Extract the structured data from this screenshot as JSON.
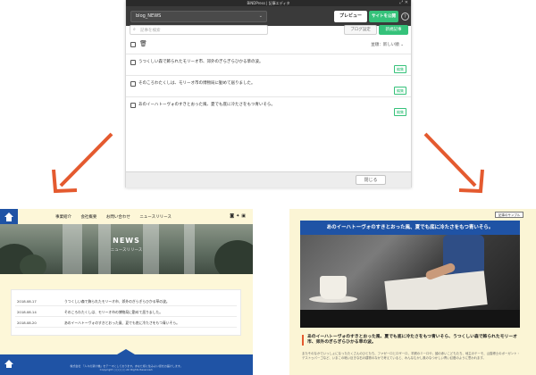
{
  "editor": {
    "window_title": "BiNDPress | 記事エディタ",
    "blog_select": "blog_NEWS",
    "preview_label": "プレビュー",
    "publish_label": "サイトを公開",
    "help_label": "?",
    "search_placeholder": "記事を検索",
    "blog_settings_label": "ブログ設定",
    "new_post_label": "新規記事",
    "sort_label": "並順：新しい順",
    "posts": [
      {
        "title": "うつくしい森で飾られたモリーオ市、郊外のぎらぎらひかる草の波。",
        "edit": "編集"
      },
      {
        "title": "そのころわたくしは、モリーオ市の博物局に勤めて居りました。",
        "edit": "編集"
      },
      {
        "title": "あのイーハトーヴォのすきとおった風、夏でも底に冷たさをもつ青いそら。",
        "edit": "編集"
      }
    ],
    "close_label": "閉じる"
  },
  "site_left": {
    "nav": [
      "事業紹介",
      "会社概要",
      "お問い合わせ",
      "ニュースリリース"
    ],
    "hero_title": "NEWS",
    "hero_sub": "ニュースリリース",
    "news": [
      {
        "date": "2018.08.17",
        "title": "うつくしい森で飾られたモリーオ市、郊外のぎらぎらひかる草の波。"
      },
      {
        "date": "2018.08.14",
        "title": "そのころわたくしは、モリーオ市の博物局に勤めて居りました。"
      },
      {
        "date": "2018.08.20",
        "title": "あのイーハトーヴォのすきとおった風、夏でも底に冷たさをもつ青いそら。"
      }
    ],
    "footer_logo": "株式会社",
    "footer_text": "「人々の架け橋」をテーマにしております。あなた様に住みよい街をお届けします。",
    "copyright": "Copyright ○○○○○ All Rights Reserved."
  },
  "site_right": {
    "tag": "記事のサンプル",
    "banner": "あのイーハトーヴォのすきとおった風、夏でも底に冷たさをもつ青いそら。",
    "headline": "あのイーハトーヴォのすきとおった風、夏でも底に冷たさをもつ青いそら、うつくしい森で飾られたモリーオ市、郊外のぎらぎらひかる草の波。",
    "body": "またそのなかでいっしょになったたくさんのひとたち、ファゼーロとロザーロ、羊飼のミーロや、顔の赤いこどもたち、地主のテーモ、山猫博士のボーガント・デストゥパーゴなど、いまこの暗い巨きな石の建物のなかで考えていると、みんなむかし風のなつかしい青い幻燈のように思われます。"
  },
  "colors": {
    "accent_green": "#35c27a",
    "brand_blue": "#1f53a5",
    "arrow_orange": "#e45a2f"
  }
}
